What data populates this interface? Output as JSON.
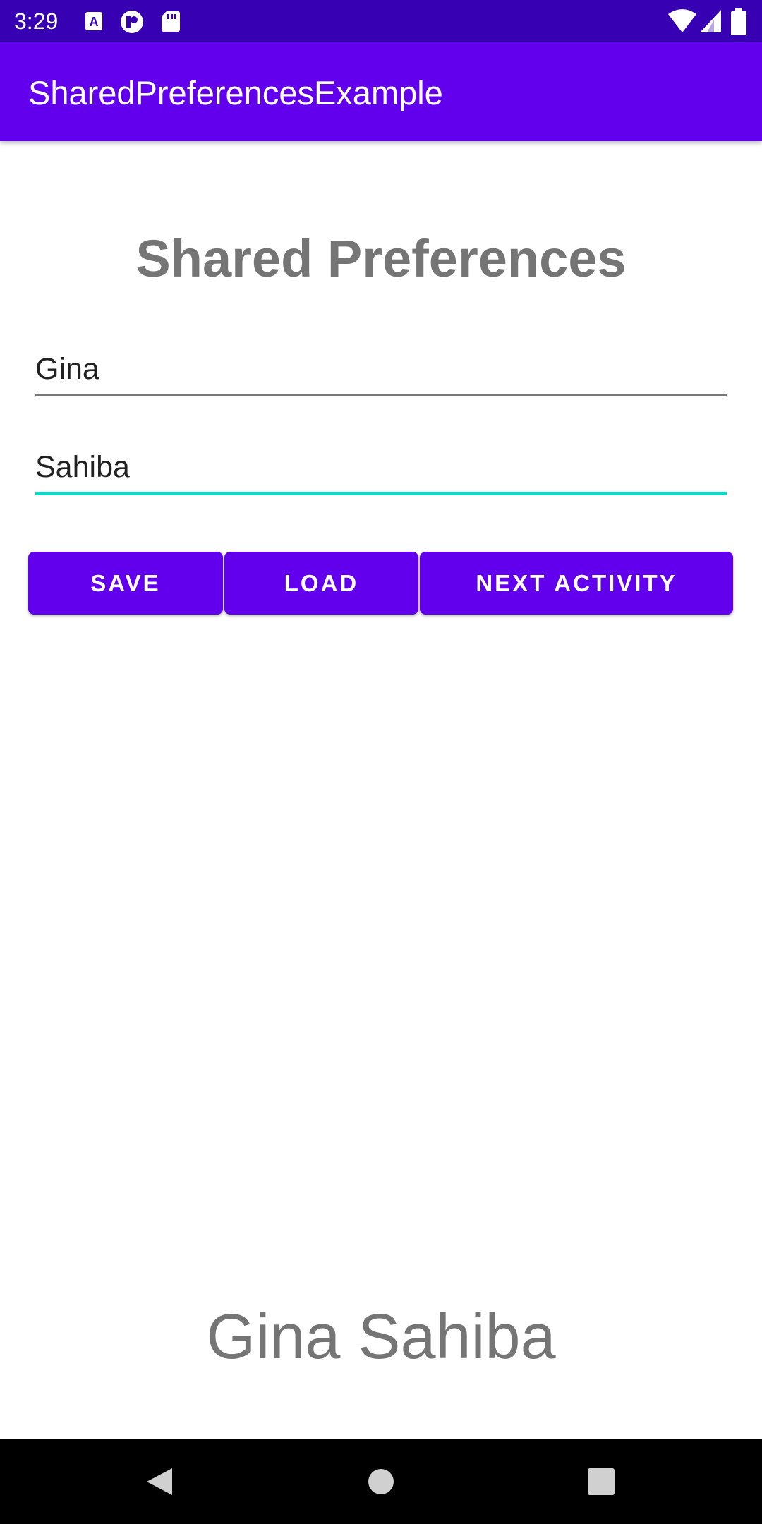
{
  "status_bar": {
    "time": "3:29",
    "left_icons": [
      "a-font-icon",
      "p-badge-icon",
      "sd-card-icon"
    ],
    "right_icons": [
      "wifi-icon",
      "signal-icon",
      "battery-icon"
    ]
  },
  "app_bar": {
    "title": "SharedPreferencesExample"
  },
  "main": {
    "heading": "Shared Preferences",
    "field_1_value": "Gina",
    "field_2_value": "Sahiba",
    "buttons": {
      "save": "SAVE",
      "load": "LOAD",
      "next": "NEXT ACTIVITY"
    },
    "result_text": "Gina Sahiba"
  },
  "nav_bar": {
    "icons": [
      "back-icon",
      "home-icon",
      "recents-icon"
    ]
  },
  "colors": {
    "status_bar": "#3700b3",
    "primary": "#6200ee",
    "accent": "#19d3c5",
    "text_grey": "#757575"
  }
}
